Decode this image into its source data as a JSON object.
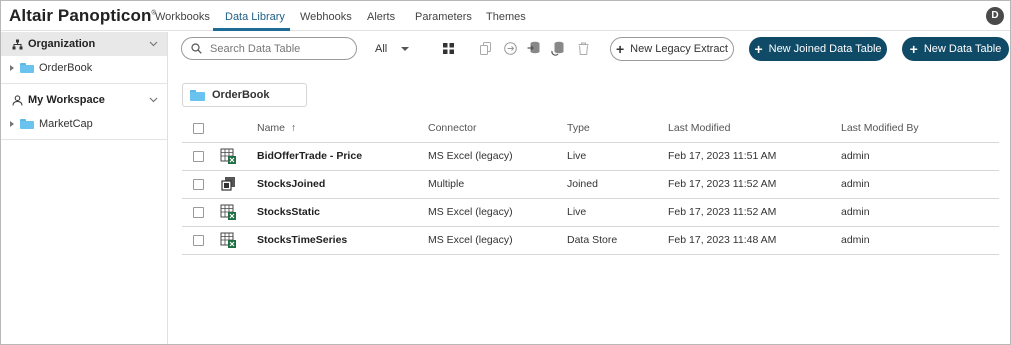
{
  "app": {
    "brand": "Altair Panopticon",
    "brand_mark": "®",
    "avatar_initial": "D"
  },
  "nav": {
    "tabs": [
      {
        "label": "Workbooks",
        "active": false
      },
      {
        "label": "Data Library",
        "active": true
      },
      {
        "label": "Webhooks",
        "active": false
      },
      {
        "label": "Alerts",
        "active": false
      },
      {
        "label": "Parameters",
        "active": false
      },
      {
        "label": "Themes",
        "active": false
      }
    ]
  },
  "sidebar": {
    "organization": {
      "label": "Organization",
      "items": [
        {
          "label": "OrderBook"
        }
      ]
    },
    "workspace": {
      "label": "My Workspace",
      "items": [
        {
          "label": "MarketCap"
        }
      ]
    }
  },
  "toolbar": {
    "search_placeholder": "Search Data Table",
    "filter_value": "All",
    "new_legacy_extract": "New Legacy Extract",
    "new_joined_data_table": "New Joined Data Table",
    "new_data_table": "New Data Table"
  },
  "breadcrumb": {
    "folder": "OrderBook"
  },
  "table": {
    "columns": {
      "name": "Name",
      "sort_indicator": "↑",
      "connector": "Connector",
      "type": "Type",
      "last_modified": "Last Modified",
      "last_modified_by": "Last Modified By"
    },
    "rows": [
      {
        "name": "BidOfferTrade - Price",
        "connector": "MS Excel (legacy)",
        "type": "Live",
        "last_modified": "Feb 17, 2023 11:51 AM",
        "last_modified_by": "admin",
        "icon": "excel-table-icon"
      },
      {
        "name": "StocksJoined",
        "connector": "Multiple",
        "type": "Joined",
        "last_modified": "Feb 17, 2023 11:52 AM",
        "last_modified_by": "admin",
        "icon": "joined-table-icon"
      },
      {
        "name": "StocksStatic",
        "connector": "MS Excel (legacy)",
        "type": "Live",
        "last_modified": "Feb 17, 2023 11:52 AM",
        "last_modified_by": "admin",
        "icon": "excel-table-icon"
      },
      {
        "name": "StocksTimeSeries",
        "connector": "MS Excel (legacy)",
        "type": "Data Store",
        "last_modified": "Feb 17, 2023 11:48 AM",
        "last_modified_by": "admin",
        "icon": "excel-table-icon"
      }
    ]
  },
  "colors": {
    "accent": "#0f4a66",
    "active_tab": "#1e6b96",
    "folder": "#69c3ee"
  }
}
